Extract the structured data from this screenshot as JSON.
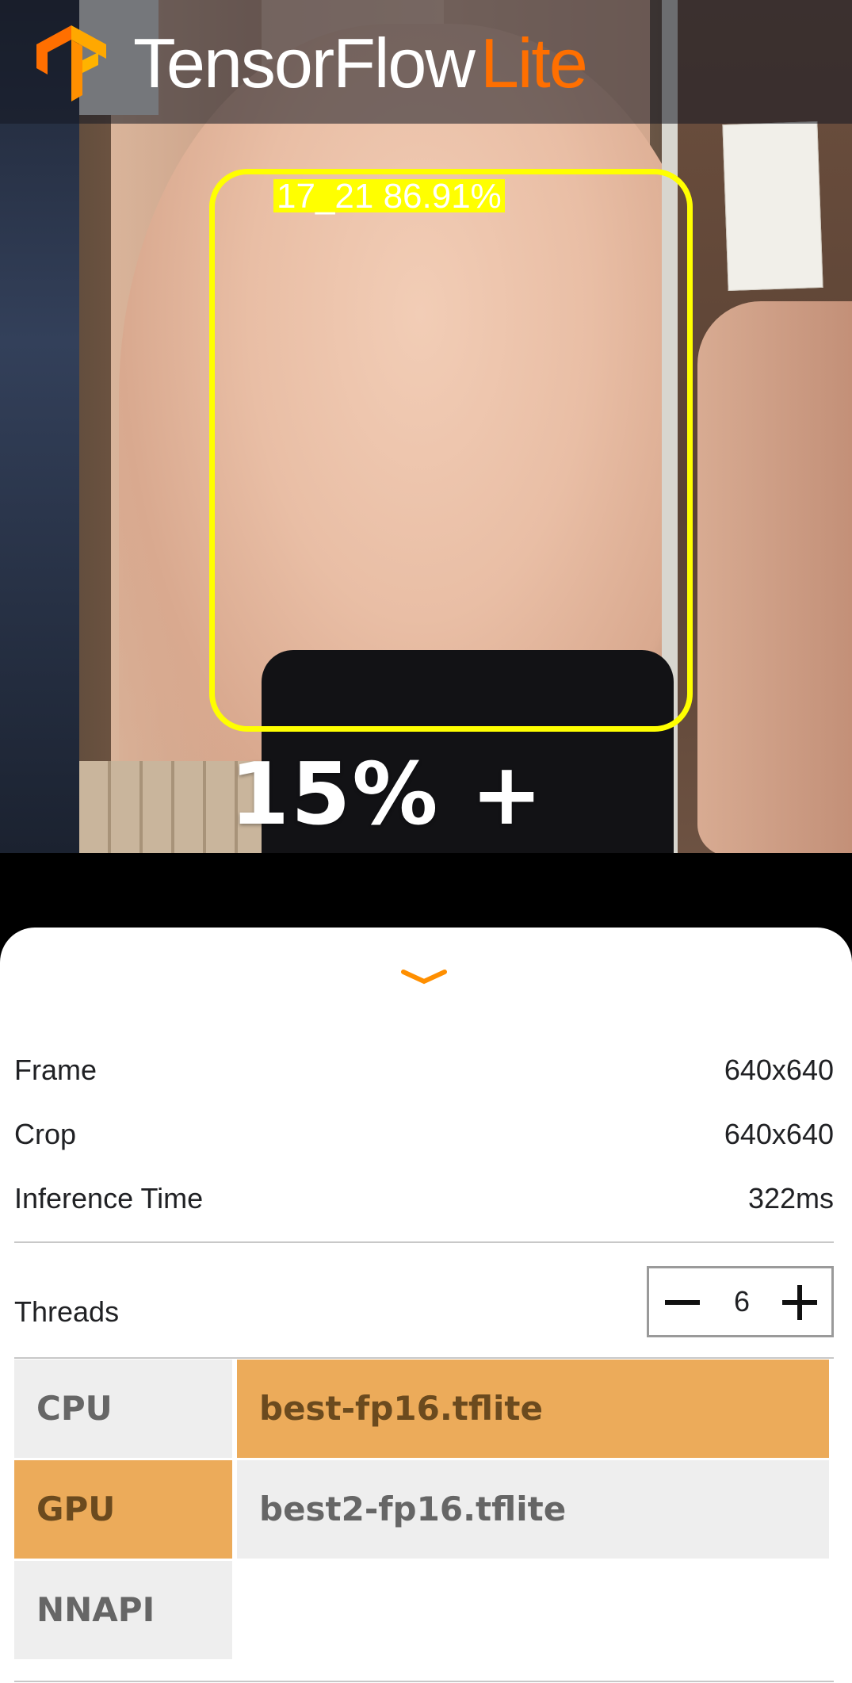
{
  "app": {
    "title_main": "TensorFlow",
    "title_accent": "Lite",
    "logo_icon": "tensorflow-logo-icon"
  },
  "camera": {
    "overlay_text": "15% +",
    "detection": {
      "label": "17_21 86.91%",
      "box_color": "#ffff00"
    }
  },
  "sheet": {
    "toggle_icon": "chevron-down-icon",
    "info": [
      {
        "key": "Frame",
        "value": "640x640"
      },
      {
        "key": "Crop",
        "value": "640x640"
      },
      {
        "key": "Inference Time",
        "value": "322ms"
      }
    ],
    "threads": {
      "label": "Threads",
      "value": "6",
      "minus_icon": "minus-icon",
      "plus_icon": "plus-icon"
    },
    "devices": {
      "options": [
        "CPU",
        "GPU",
        "NNAPI"
      ],
      "selected": "GPU"
    },
    "models": {
      "options": [
        "best-fp16.tflite",
        "best2-fp16.tflite"
      ],
      "selected": "best-fp16.tflite"
    }
  },
  "colors": {
    "accent": "#ff6f00",
    "selected": "#ecab5a",
    "unselected": "#eeeeee"
  }
}
